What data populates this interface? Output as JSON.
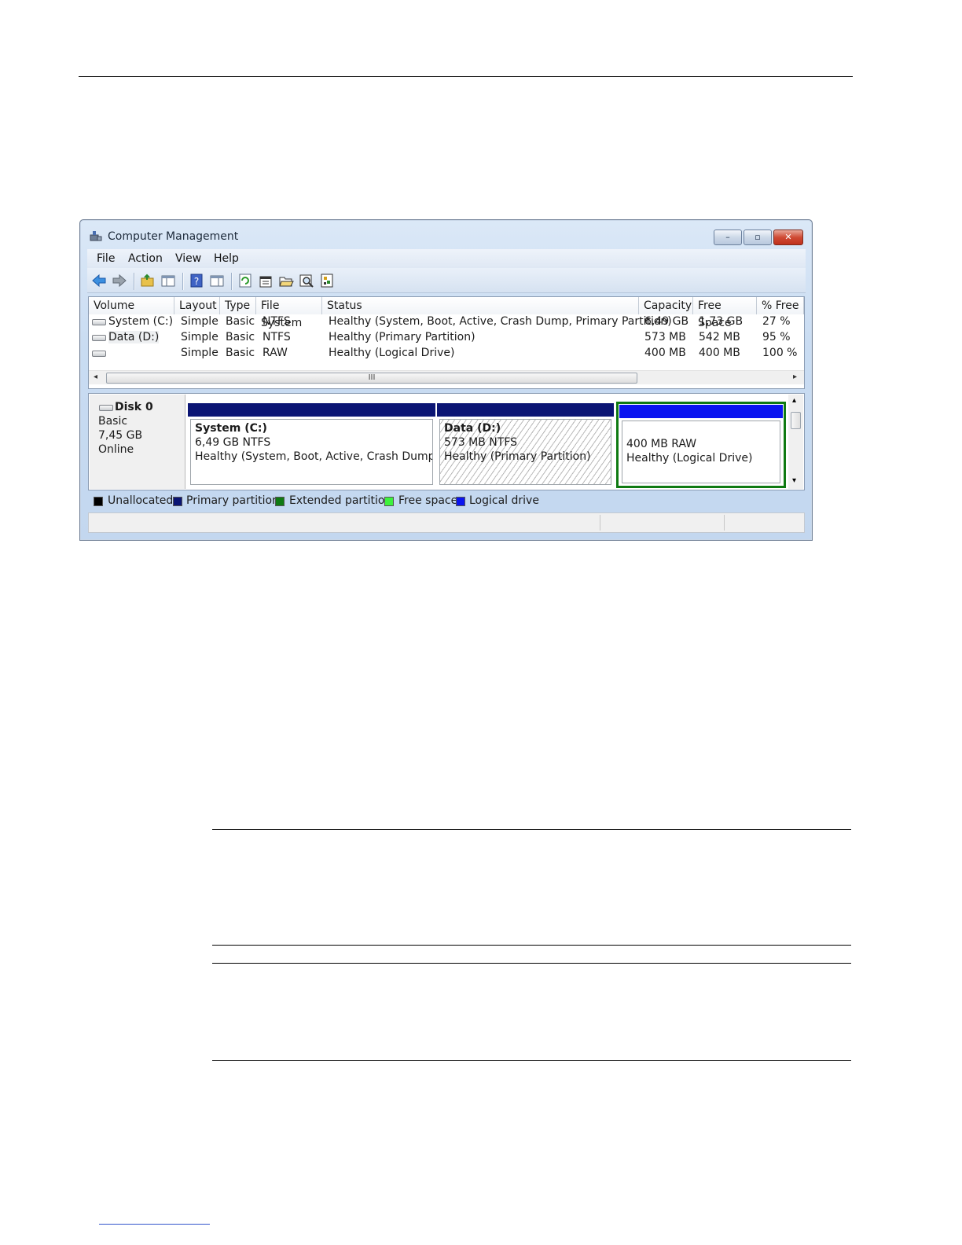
{
  "window": {
    "title": "Computer Management",
    "controls": {
      "minimize": "–",
      "maximize": "▫",
      "close": "✕"
    }
  },
  "menu": [
    "File",
    "Action",
    "View",
    "Help"
  ],
  "toolbar_icons": [
    "back-arrow-icon",
    "forward-arrow-icon",
    "up-folder-icon",
    "show-hide-tree-icon",
    "help-icon",
    "console-pane-icon",
    "refresh-icon",
    "properties-icon",
    "open-folder-icon",
    "search-icon",
    "settings-icon"
  ],
  "volume_table": {
    "columns": [
      "Volume",
      "Layout",
      "Type",
      "File System",
      "Status",
      "Capacity",
      "Free Space",
      "% Free"
    ],
    "rows": [
      {
        "volume": "System (C:)",
        "layout": "Simple",
        "type": "Basic",
        "fs": "NTFS",
        "status": "Healthy (System, Boot, Active, Crash Dump, Primary Partition)",
        "capacity": "6,49 GB",
        "free": "1,73 GB",
        "pct": "27 %"
      },
      {
        "volume": "Data (D:)",
        "layout": "Simple",
        "type": "Basic",
        "fs": "NTFS",
        "status": "Healthy (Primary Partition)",
        "capacity": "573 MB",
        "free": "542 MB",
        "pct": "95 %"
      },
      {
        "volume": "",
        "layout": "Simple",
        "type": "Basic",
        "fs": "RAW",
        "status": "Healthy (Logical Drive)",
        "capacity": "400 MB",
        "free": "400 MB",
        "pct": "100 %"
      }
    ],
    "scroll_grip": "III",
    "scroll_left": "◂",
    "scroll_right": "▸"
  },
  "disk": {
    "name": "Disk 0",
    "type": "Basic",
    "size": "7,45 GB",
    "state": "Online",
    "partitions": [
      {
        "title": "System  (C:)",
        "line1": "6,49 GB NTFS",
        "line2": "Healthy (System, Boot, Active, Crash Dump, Prir"
      },
      {
        "title": "Data  (D:)",
        "line1": "573 MB NTFS",
        "line2": "Healthy (Primary Partition)"
      },
      {
        "title": "",
        "line1": "400 MB RAW",
        "line2": "Healthy (Logical Drive)"
      }
    ],
    "scroll_up": "▴",
    "scroll_down": "▾"
  },
  "legend": [
    {
      "label": "Unallocated",
      "color": "#000000"
    },
    {
      "label": "Primary partition",
      "color": "#0b1574"
    },
    {
      "label": "Extended partition",
      "color": "#0f7a12"
    },
    {
      "label": "Free space",
      "color": "#3df23d"
    },
    {
      "label": "Logical drive",
      "color": "#0a14f0"
    }
  ],
  "colors": {
    "primary_bar": "#0b1574",
    "logical_bar": "#0a14f0",
    "extended_border": "#0f7a12"
  }
}
